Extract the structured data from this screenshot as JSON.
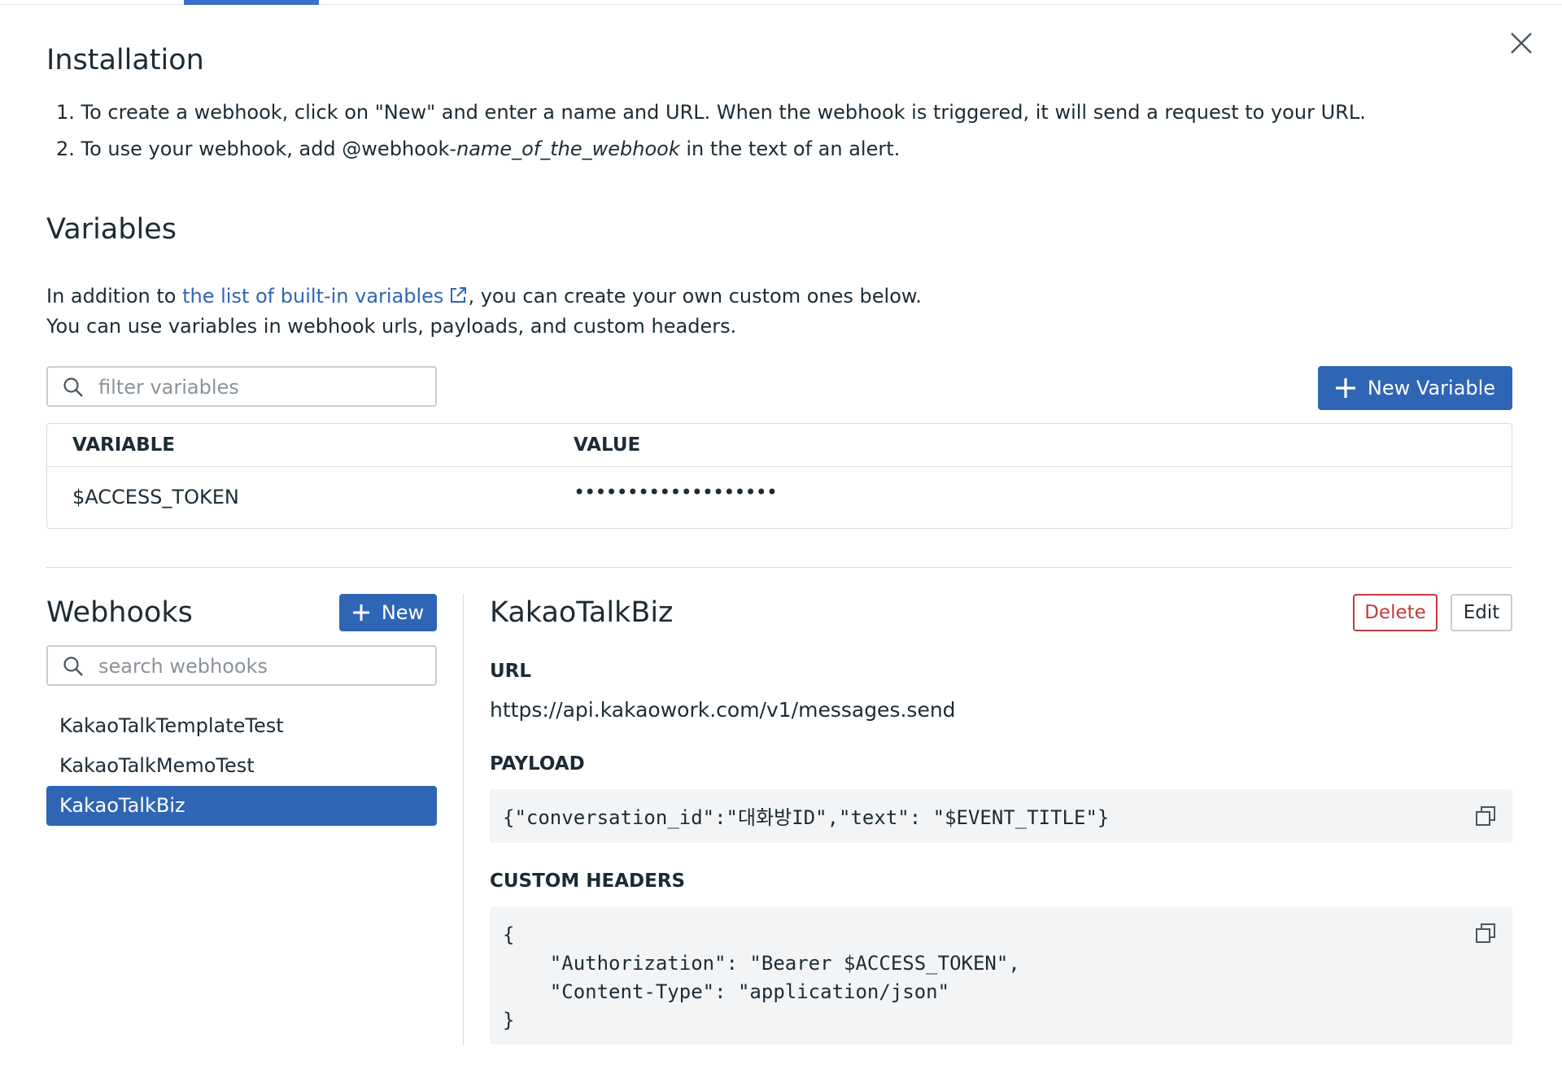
{
  "installation": {
    "title": "Installation",
    "step1": "1. To create a webhook, click on \"New\" and enter a name and URL. When the webhook is triggered, it will send a request to your URL.",
    "step2_prefix": "2. To use your webhook, add @webhook-",
    "step2_italic": "name_of_the_webhook",
    "step2_suffix": " in the text of an alert."
  },
  "variables": {
    "title": "Variables",
    "desc_prefix": "In addition to ",
    "desc_link": "the list of built-in variables",
    "desc_suffix": ", you can create your own custom ones below.",
    "desc_line2": "You can use variables in webhook urls, payloads, and custom headers.",
    "filter_placeholder": "filter variables",
    "new_button": "New Variable",
    "columns": {
      "variable": "VARIABLE",
      "value": "VALUE"
    },
    "rows": [
      {
        "name": "$ACCESS_TOKEN",
        "value": "•••••••••••••••••••"
      }
    ]
  },
  "webhooks": {
    "title": "Webhooks",
    "new_button": "New",
    "search_placeholder": "search webhooks",
    "items": [
      {
        "label": "KakaoTalkTemplateTest"
      },
      {
        "label": "KakaoTalkMemoTest"
      },
      {
        "label": "KakaoTalkBiz"
      }
    ],
    "selected_index": 2
  },
  "detail": {
    "title": "KakaoTalkBiz",
    "delete_button": "Delete",
    "edit_button": "Edit",
    "url_label": "URL",
    "url_value": "https://api.kakaowork.com/v1/messages.send",
    "payload_label": "PAYLOAD",
    "payload_value": "{\"conversation_id\":\"대화방ID\",\"text\": \"$EVENT_TITLE\"}",
    "headers_label": "CUSTOM HEADERS",
    "headers_value": "{\n    \"Authorization\": \"Bearer $ACCESS_TOKEN\",\n    \"Content-Type\": \"application/json\"\n}"
  },
  "colors": {
    "primary": "#2f65b5",
    "danger": "#c33a3a",
    "border": "#d9dce2",
    "code_bg": "#f3f4f6"
  },
  "icons": {
    "close": "close-icon",
    "search": "search-icon",
    "plus": "plus-icon",
    "external": "external-link-icon",
    "copy": "copy-icon"
  }
}
